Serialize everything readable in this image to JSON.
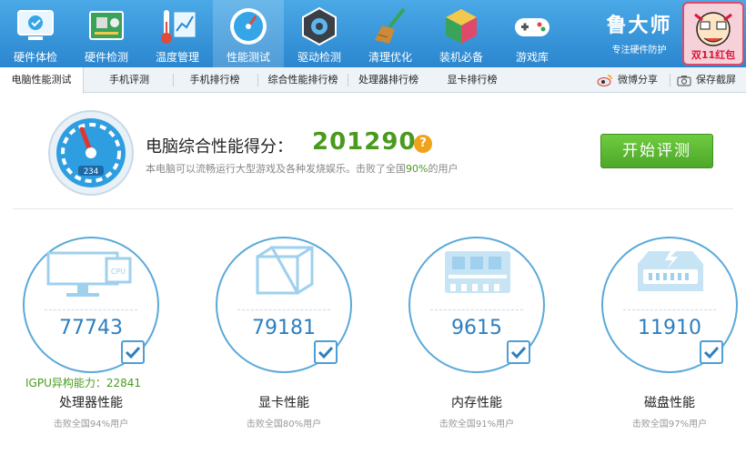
{
  "nav": [
    {
      "label": "硬件体检",
      "icon": "monitor-check-icon"
    },
    {
      "label": "硬件检测",
      "icon": "circuit-board-icon"
    },
    {
      "label": "温度管理",
      "icon": "thermometer-icon"
    },
    {
      "label": "性能测试",
      "icon": "speedometer-icon"
    },
    {
      "label": "驱动检测",
      "icon": "gear-chip-icon"
    },
    {
      "label": "清理优化",
      "icon": "broom-icon"
    },
    {
      "label": "装机必备",
      "icon": "cube-box-icon"
    },
    {
      "label": "游戏库",
      "icon": "gamepad-icon"
    }
  ],
  "brand": {
    "name": "鲁大师",
    "tagline": "专注硬件防护",
    "promo_text": "双11红包"
  },
  "tabs": [
    "电脑性能测试",
    "手机评测",
    "手机排行榜",
    "综合性能排行榜",
    "处理器排行榜",
    "显卡排行榜"
  ],
  "share": {
    "weibo": "微博分享",
    "screenshot": "保存截屏"
  },
  "score": {
    "title": "电脑综合性能得分：",
    "value": "201290",
    "help": "?",
    "desc_prefix": "本电脑可以流畅运行大型游戏及各种发烧娱乐。击败了全国",
    "desc_pct": "90%",
    "desc_suffix": "的用户",
    "gauge_readout": "234",
    "start_button": "开始评测"
  },
  "igpu": "IGPU异构能力：22841",
  "metrics": [
    {
      "name": "处理器性能",
      "score": "77743",
      "beat": "击败全国94%用户",
      "icon": "cpu-monitor-icon"
    },
    {
      "name": "显卡性能",
      "score": "79181",
      "beat": "击败全国80%用户",
      "icon": "gpu-cube-icon"
    },
    {
      "name": "内存性能",
      "score": "9615",
      "beat": "击败全国91%用户",
      "icon": "memory-chip-icon"
    },
    {
      "name": "磁盘性能",
      "score": "11910",
      "beat": "击败全国97%用户",
      "icon": "disk-drive-icon"
    }
  ],
  "colors": {
    "topbar": "#2b86cf",
    "accent_green": "#4a9a1f",
    "circle_blue": "#5aa9d9",
    "score_blue": "#2d7fc0"
  }
}
